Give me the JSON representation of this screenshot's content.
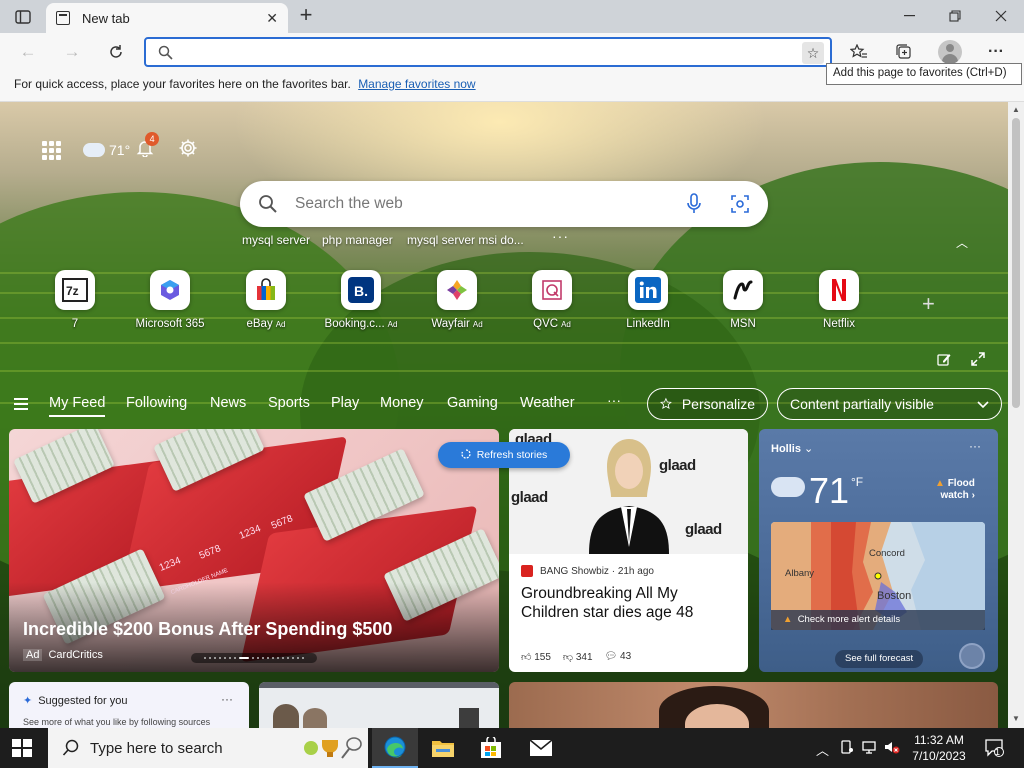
{
  "browser": {
    "tab_title": "New tab",
    "address_value": "",
    "favorites_hint": "For quick access, place your favorites here on the favorites bar.",
    "favorites_link": "Manage favorites now",
    "tooltip": "Add this page to favorites (Ctrl+D)"
  },
  "header": {
    "temperature": "71°",
    "notifications": "4"
  },
  "search": {
    "placeholder": "Search the web",
    "suggestions": [
      "mysql server",
      "php manager",
      "mysql server msi do..."
    ]
  },
  "quick_links": [
    {
      "label": "7",
      "ad": ""
    },
    {
      "label": "Microsoft 365",
      "ad": ""
    },
    {
      "label": "eBay",
      "ad": "Ad"
    },
    {
      "label": "Booking.c...",
      "ad": "Ad"
    },
    {
      "label": "Wayfair",
      "ad": "Ad"
    },
    {
      "label": "QVC",
      "ad": "Ad"
    },
    {
      "label": "LinkedIn",
      "ad": ""
    },
    {
      "label": "MSN",
      "ad": ""
    },
    {
      "label": "Netflix",
      "ad": ""
    }
  ],
  "feed_nav": {
    "items": [
      "My Feed",
      "Following",
      "News",
      "Sports",
      "Play",
      "Money",
      "Gaming",
      "Weather"
    ],
    "personalize": "Personalize",
    "visibility": "Content partially visible"
  },
  "cards": {
    "refresh": "Refresh stories",
    "main": {
      "headline": "Incredible $200 Bonus After Spending $500",
      "ad_label": "Ad",
      "source": "CardCritics",
      "card_text": [
        "1234",
        "5678",
        "1234",
        "5678",
        "CARDHOLDER NAME"
      ]
    },
    "story": {
      "source": "BANG Showbiz",
      "age": "21h ago",
      "headline": "Groundbreaking All My Children star dies age 48",
      "likes": "155",
      "dislikes": "341",
      "comments": "43",
      "photo_text": "glaad"
    },
    "weather": {
      "location": "Hollis",
      "temp": "71",
      "unit": "°F",
      "alert_line1": "Flood",
      "alert_line2": "watch",
      "map_labels": [
        "Concord",
        "Albany",
        "Boston"
      ],
      "details": "Check more alert details",
      "forecast": "See full forecast"
    },
    "suggested": {
      "title": "Suggested for you",
      "subtitle": "See more of what you like by following sources"
    }
  },
  "taskbar": {
    "search_placeholder": "Type here to search",
    "time": "11:32 AM",
    "date": "7/10/2023",
    "notif_count": "1"
  }
}
